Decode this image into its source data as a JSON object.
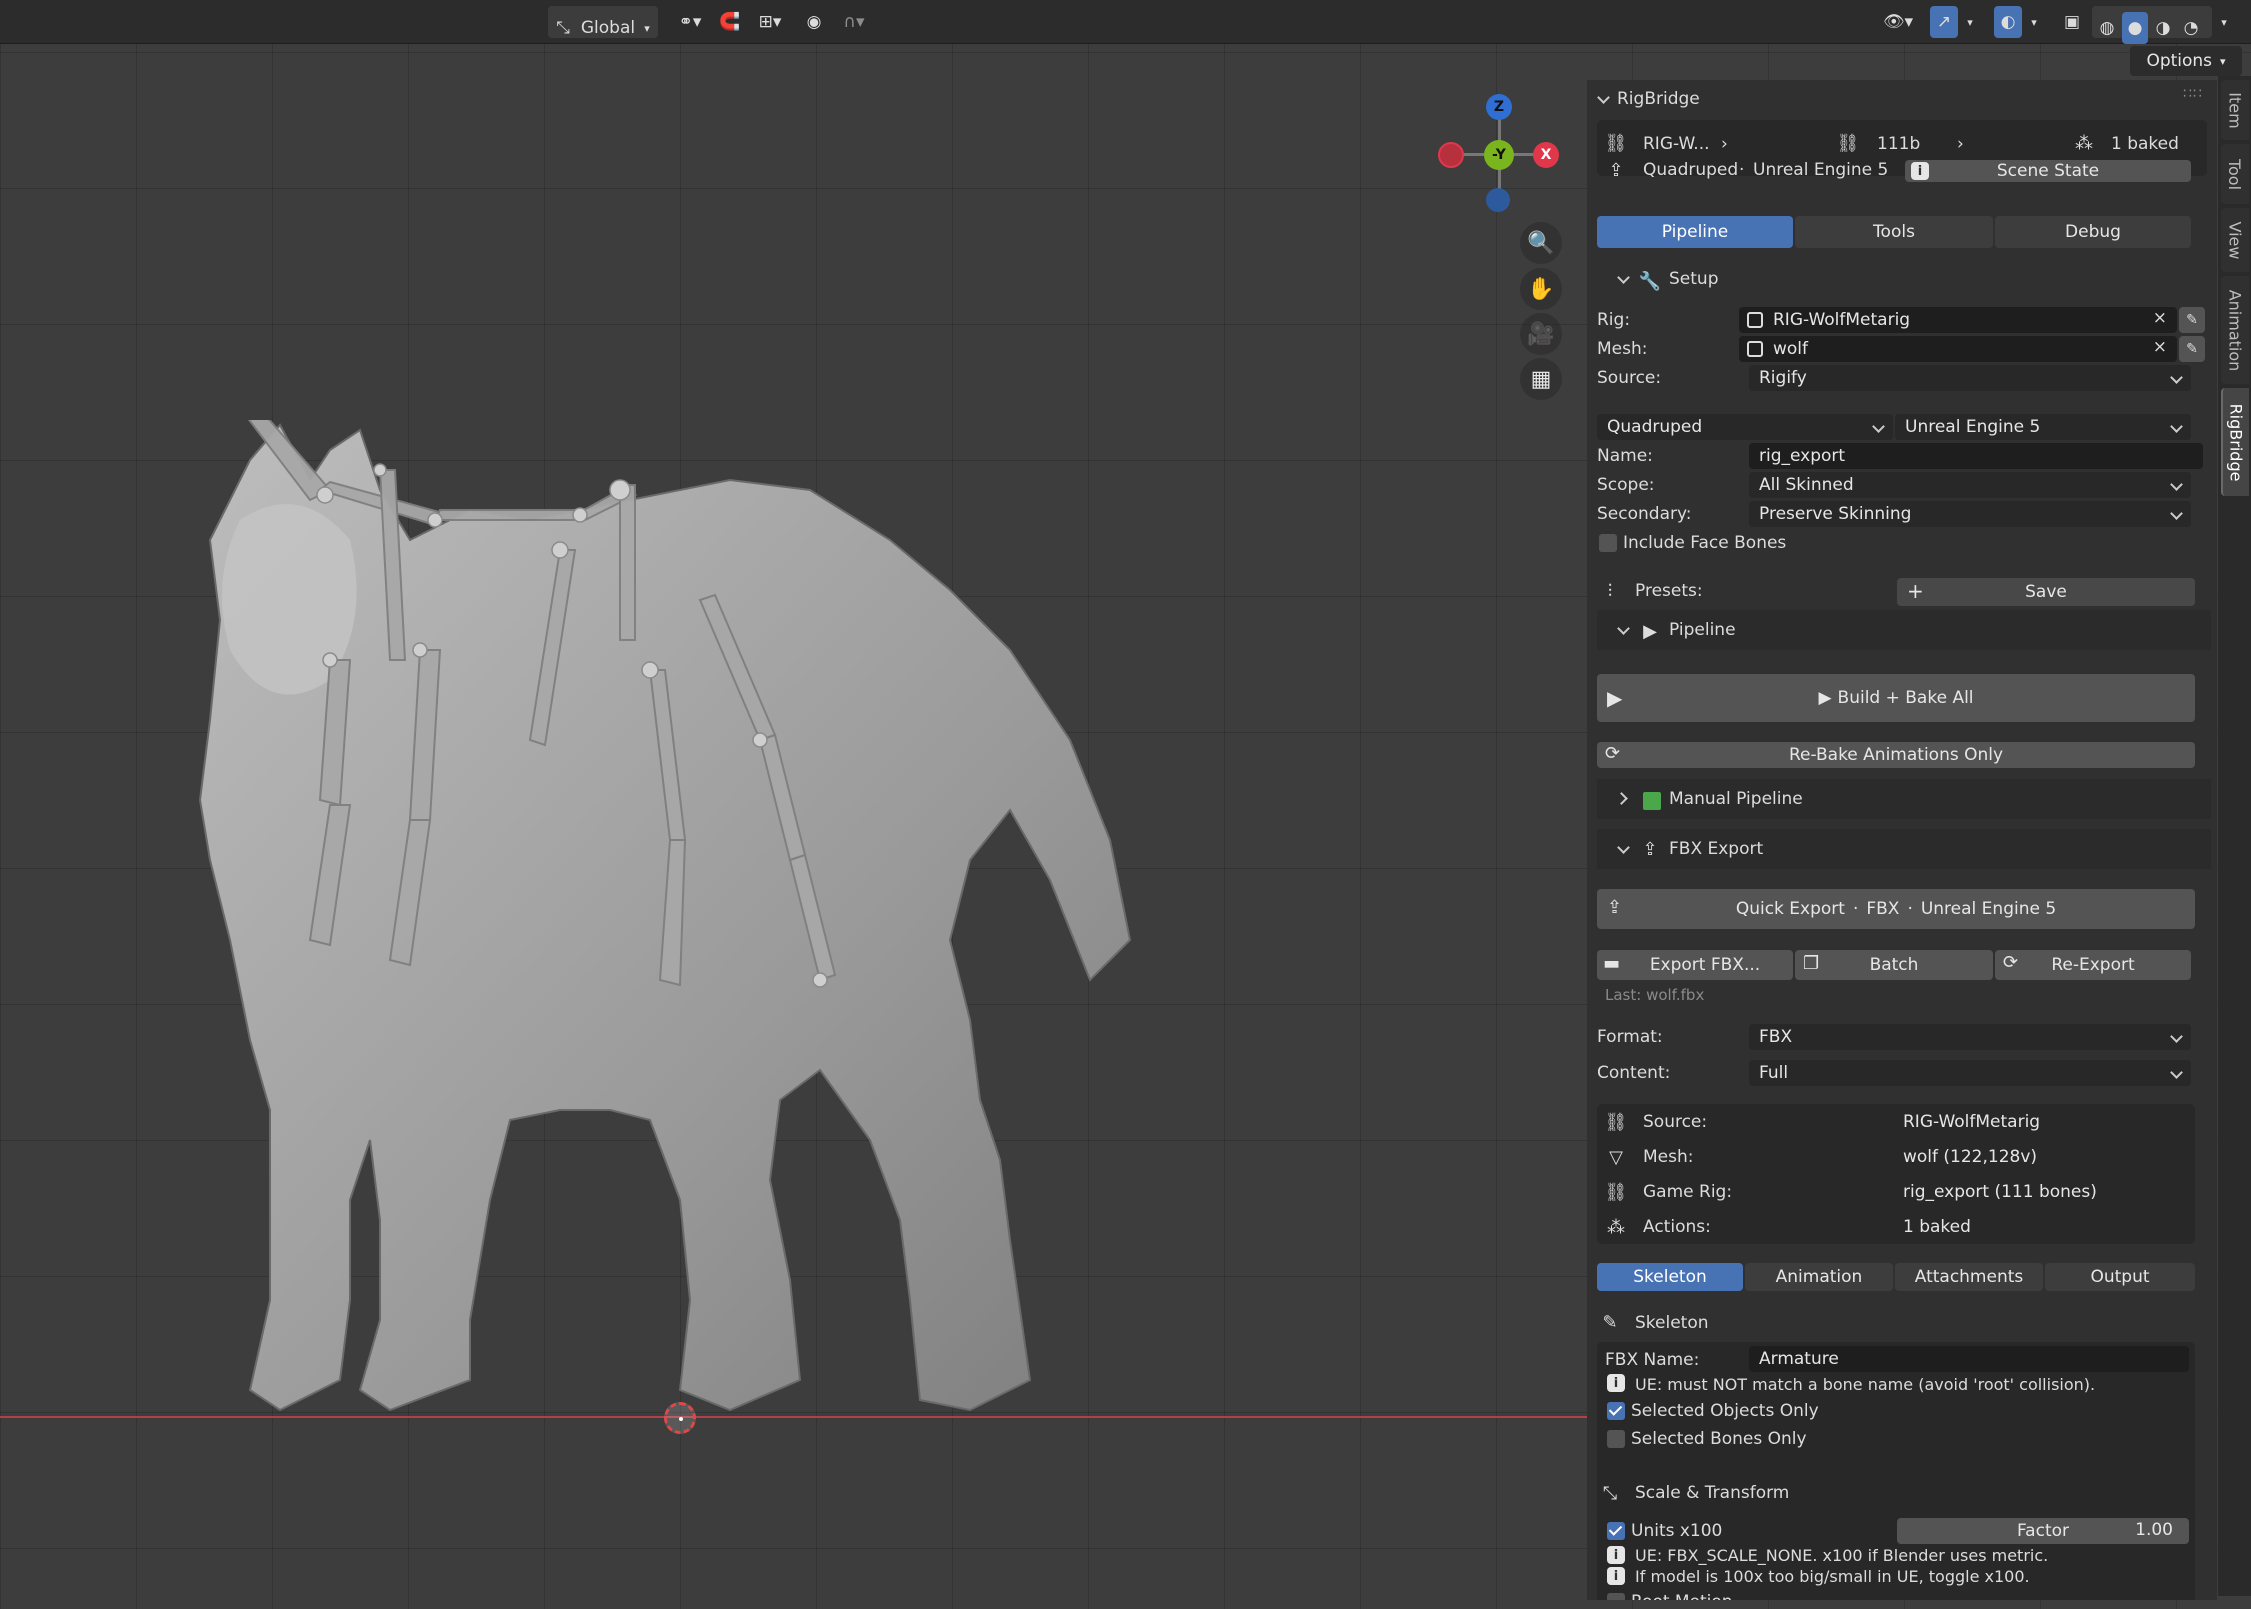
{
  "header": {
    "transform_orientation": "Global",
    "options_label": "Options"
  },
  "gizmo": {
    "z": "Z",
    "y": "-Y",
    "x": "X"
  },
  "vertical_tabs": [
    "Item",
    "Tool",
    "View",
    "Animation",
    "RigBridge"
  ],
  "panel": {
    "title": "RigBridge",
    "summary": {
      "rig": "RIG-W...",
      "bones": "111b",
      "baked": "1 baked",
      "template": "Quadruped",
      "sep": "·",
      "target": "Unreal Engine 5",
      "scene_state_label": "Scene State"
    },
    "tabs": [
      "Pipeline",
      "Tools",
      "Debug"
    ],
    "setup": {
      "title": "Setup",
      "rig_label": "Rig:",
      "rig_value": "RIG-WolfMetarig",
      "mesh_label": "Mesh:",
      "mesh_value": "wolf",
      "source_label": "Source:",
      "source_value": "Rigify",
      "template_value": "Quadruped",
      "target_value": "Unreal Engine 5",
      "name_label": "Name:",
      "name_value": "rig_export",
      "scope_label": "Scope:",
      "scope_value": "All Skinned",
      "secondary_label": "Secondary:",
      "secondary_value": "Preserve Skinning",
      "face_bones_label": "Include Face Bones",
      "face_bones_checked": false,
      "presets_label": "Presets:",
      "save_label": "Save"
    },
    "pipeline": {
      "title": "Pipeline",
      "build_bake_label": "Build + Bake All",
      "rebake_label": "Re-Bake Animations Only",
      "manual_label": "Manual Pipeline"
    },
    "fbx_export": {
      "title": "FBX Export",
      "quick_export_label": "Quick Export",
      "quick_export_format": "FBX",
      "quick_export_target": "Unreal Engine 5",
      "sep": "·",
      "export_fbx_label": "Export FBX...",
      "batch_label": "Batch",
      "reexport_label": "Re-Export",
      "last_file": "Last: wolf.fbx",
      "format_label": "Format:",
      "format_value": "FBX",
      "content_label": "Content:",
      "content_value": "Full",
      "info_rows": [
        {
          "label": "Source:",
          "value": "RIG-WolfMetarig"
        },
        {
          "label": "Mesh:",
          "value": "wolf  (122,128v)"
        },
        {
          "label": "Game Rig:",
          "value": "rig_export  (111 bones)"
        },
        {
          "label": "Actions:",
          "value": "1 baked"
        }
      ],
      "subtabs": [
        "Skeleton",
        "Animation",
        "Attachments",
        "Output"
      ]
    },
    "skeleton": {
      "title": "Skeleton",
      "fbx_name_label": "FBX Name:",
      "fbx_name_value": "Armature",
      "note": "UE: must NOT match a bone name (avoid 'root' collision).",
      "selected_objects_label": "Selected Objects Only",
      "selected_objects_checked": true,
      "selected_bones_label": "Selected Bones Only",
      "selected_bones_checked": false
    },
    "scale": {
      "title": "Scale & Transform",
      "units_label": "Units x100",
      "units_checked": true,
      "factor_label": "Factor",
      "factor_value": "1.00",
      "note1": "UE: FBX_SCALE_NONE. x100 if Blender uses metric.",
      "note2": "If model is 100x too big/small in UE, toggle x100.",
      "root_motion_label": "Root Motion"
    }
  }
}
